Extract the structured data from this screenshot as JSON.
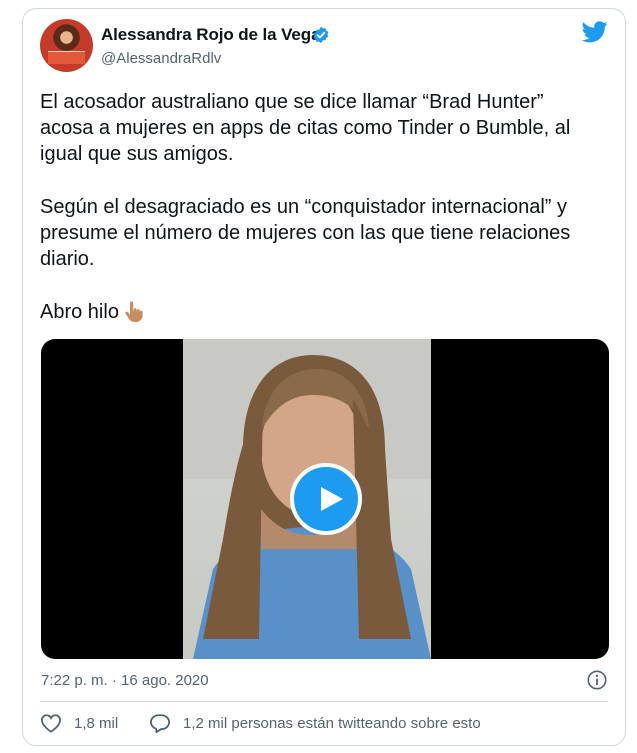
{
  "tweet": {
    "author_name": "Alessandra Rojo de la Vega",
    "author_handle": "@AlessandraRdlv",
    "verified": true,
    "paragraphs": [
      "El acosador australiano que se dice llamar “Brad Hunter”\nacosa a mujeres en apps de citas como Tinder o Bumble, al\nigual que sus amigos.",
      "Según el desagraciado es un “conquistador internacional” y\npresume el número de mujeres con las que tiene relaciones\ndiario.",
      "Abro hilo"
    ],
    "timestamp": "7:22 p. m. · 16 ago. 2020",
    "likes": "1,8 mil",
    "talking": "1,2 mil personas están twitteando sobre esto"
  },
  "icons": {
    "brand": "twitter-bird-icon",
    "verified": "verified-badge-icon",
    "emoji": "pointing-down-hand-icon",
    "media_action": "play-icon",
    "info": "info-icon",
    "like": "heart-icon",
    "reply": "speech-bubble-icon"
  },
  "colors": {
    "accent": "#1d9bf0",
    "secondary_text": "#536471",
    "border": "#cfd9de"
  }
}
